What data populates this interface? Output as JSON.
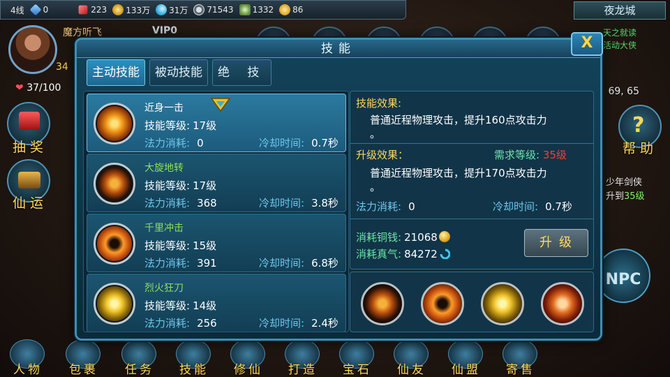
{
  "hud": {
    "line": "4线",
    "diamond": "0",
    "ruby": "223",
    "copper": "133万",
    "qi": "31万",
    "power": "71543",
    "honor": "1332",
    "heart": "86",
    "city": "夜龙城",
    "coords": "69, 65",
    "player_name": "魔方听飞",
    "vip": "VIP0",
    "level": "34",
    "hp": "37/100",
    "colors": {
      "accent": "#3d8fb4",
      "gold": "#ffd75a",
      "skill_key": "#6cc6ea",
      "red": "#ff3b2f"
    }
  },
  "side": {
    "draw": "抽奖",
    "fortune": "仙运",
    "help": "帮助",
    "npc": "NPC",
    "green_1": "天之就读",
    "green_2": "活动大侠",
    "quest_title": "少年剑侠",
    "quest_pre": "升到",
    "quest_level": "35级"
  },
  "bottom": [
    "人物",
    "包裹",
    "任务",
    "技能",
    "修仙",
    "打造",
    "宝石",
    "仙友",
    "仙盟",
    "寄售"
  ],
  "dialog": {
    "title": "技能",
    "close": "X",
    "tabs": [
      "主动技能",
      "被动技能",
      "绝 技"
    ],
    "labels": {
      "level": "技能等级:",
      "cost": "法力消耗:",
      "cd": "冷却时间:"
    },
    "skills": [
      {
        "name": "近身一击",
        "level": "17级",
        "cost": "0",
        "cd": "0.7秒",
        "icon": "slash-skill-icon",
        "name_color": "#ffffff"
      },
      {
        "name": "大旋地转",
        "level": "17级",
        "cost": "368",
        "cd": "3.8秒",
        "icon": "whirl-skill-icon",
        "name_color": "#8ee05a"
      },
      {
        "name": "千里冲击",
        "level": "15级",
        "cost": "391",
        "cd": "6.8秒",
        "icon": "rush-skill-icon",
        "name_color": "#8ee05a"
      },
      {
        "name": "烈火狂刀",
        "level": "14级",
        "cost": "256",
        "cd": "2.4秒",
        "icon": "blade-skill-icon",
        "name_color": "#8ee05a"
      }
    ],
    "detail": {
      "effect_title": "技能效果:",
      "effect_text": "普通近程物理攻击，提升160点攻击力",
      "effect_tail": "。",
      "upgrade_title": "升级效果：",
      "req_label": "需求等级:",
      "req_value": "35级",
      "upgrade_text": "普通近程物理攻击，提升170点攻击力",
      "upgrade_tail": "。",
      "cost_label": "法力消耗:",
      "cost_value": "0",
      "cd_label": "冷却时间:",
      "cd_value": "0.7秒",
      "copper_label": "消耗铜钱:",
      "copper_value": "21068",
      "qi_label": "消耗真气:",
      "qi_value": "84272",
      "upgrade_button": "升级"
    },
    "slots": [
      "whirl-skill-icon",
      "rush-skill-icon",
      "blade-skill-icon",
      "burst-skill-icon"
    ]
  }
}
